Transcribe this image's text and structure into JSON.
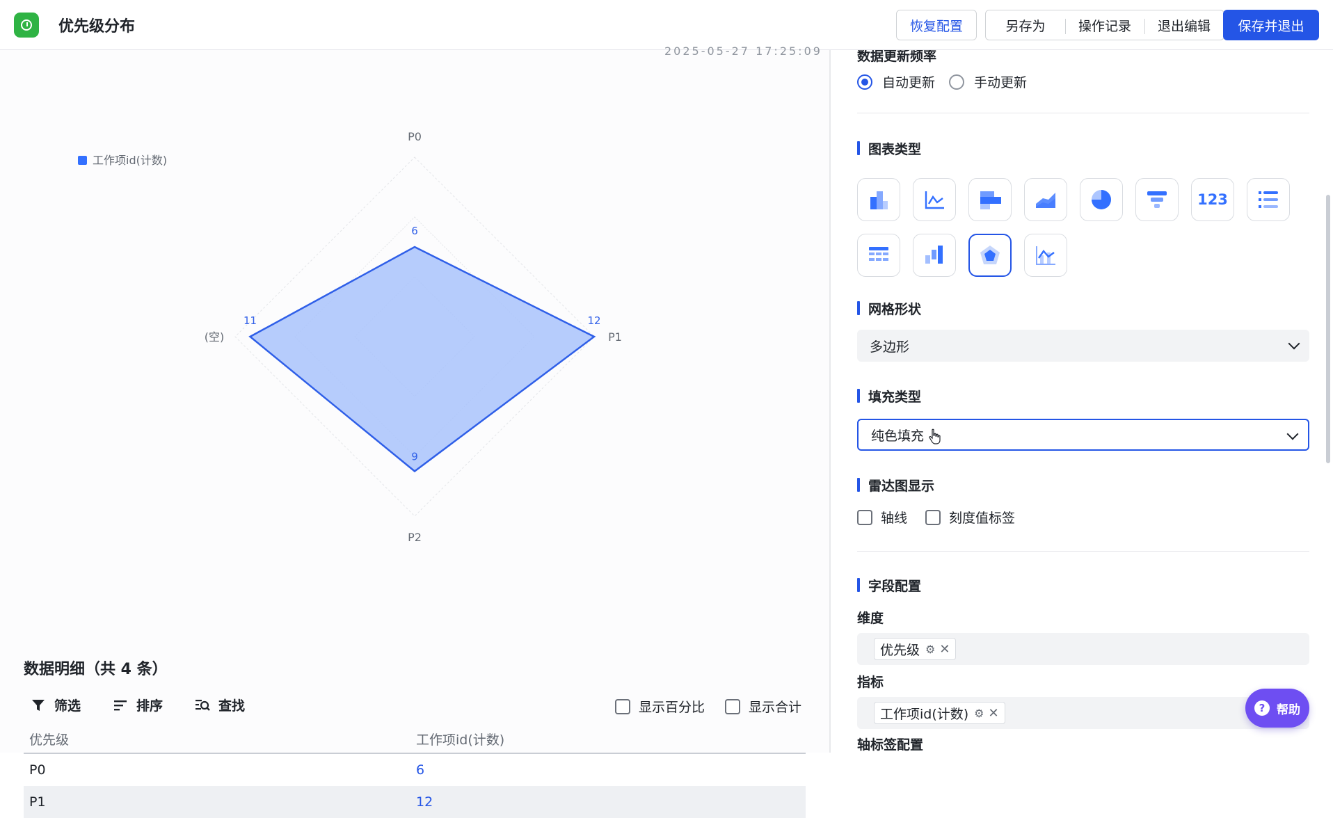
{
  "header": {
    "title": "优先级分布",
    "restore_label": "恢复配置",
    "save_as_label": "另存为",
    "history_label": "操作记录",
    "exit_edit_label": "退出编辑",
    "save_exit_label": "保存并退出"
  },
  "chart": {
    "date_partial": "2025-05-27 17:25:09",
    "legend_label": "工作项id(计数)",
    "legend_color": "#3370ff",
    "fill_color": "#a9c3fb",
    "line_color": "#2f5fe8"
  },
  "chart_data": {
    "type": "radar",
    "axes": [
      "P0",
      "P1",
      "P2",
      "(空)"
    ],
    "max": 12,
    "series": [
      {
        "name": "工作项id(计数)",
        "values": [
          6,
          12,
          9,
          11
        ]
      }
    ]
  },
  "detail": {
    "title": "数据明细（共 4 条）",
    "filter_label": "筛选",
    "sort_label": "排序",
    "find_label": "查找",
    "show_percent_label": "显示百分比",
    "show_total_label": "显示合计",
    "columns": [
      "优先级",
      "工作项id(计数)"
    ],
    "rows": [
      [
        "P0",
        "6"
      ],
      [
        "P1",
        "12"
      ]
    ]
  },
  "panel": {
    "update_freq_label": "数据更新频率",
    "auto_update_label": "自动更新",
    "manual_update_label": "手动更新",
    "chart_type_title": "图表类型",
    "grid_shape_title": "网格形状",
    "grid_shape_value": "多边形",
    "fill_type_title": "填充类型",
    "fill_type_value": "纯色填充",
    "radar_display_title": "雷达图显示",
    "axis_line_label": "轴线",
    "tick_label_label": "刻度值标签",
    "field_config_title": "字段配置",
    "dimension_label": "维度",
    "dimension_value": "优先级",
    "metric_label": "指标",
    "metric_value": "工作项id(计数)",
    "axis_label_config": "轴标签配置",
    "number_chart_glyph": "123"
  },
  "help": {
    "label": "帮助"
  }
}
